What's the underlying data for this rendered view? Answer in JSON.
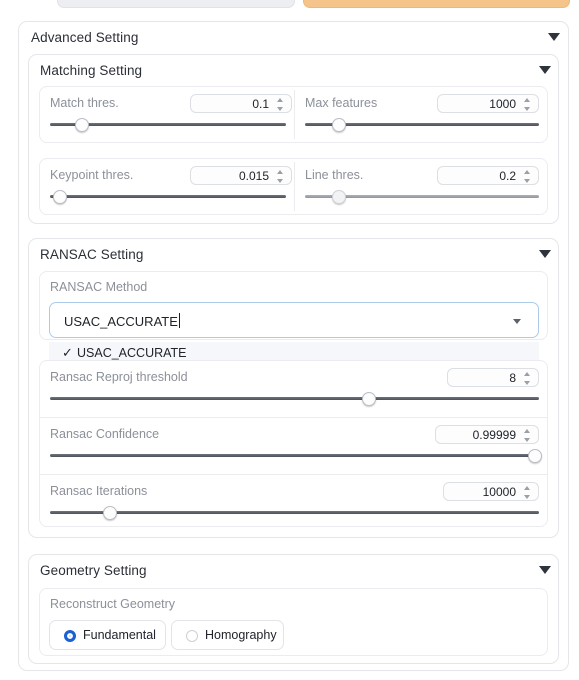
{
  "top_buttons": [
    {
      "name": "gray-button",
      "label": ""
    },
    {
      "name": "orange-button",
      "label": ""
    }
  ],
  "advanced": {
    "title": "Advanced Setting",
    "collapse_icon": "triangle-down-icon"
  },
  "matching": {
    "title": "Matching Setting",
    "fields": [
      {
        "label": "Match thres.",
        "value": "0.1",
        "slider_pct": 13
      },
      {
        "label": "Max features",
        "value": "1000",
        "slider_pct": 14
      },
      {
        "label": "Keypoint thres.",
        "value": "0.015",
        "slider_pct": 4
      },
      {
        "label": "Line thres.",
        "value": "0.2",
        "slider_pct": 14
      }
    ]
  },
  "ransac": {
    "title": "RANSAC Setting",
    "method_label": "RANSAC Method",
    "method_value": "USAC_ACCURATE",
    "dropdown_open": true,
    "options": [
      {
        "label": "USAC_ACCURATE",
        "selected": true,
        "check": "✓"
      }
    ],
    "fields": [
      {
        "label": "Ransac Reproj threshold",
        "value": "8",
        "slider_pct": 65
      },
      {
        "label": "Ransac Confidence",
        "value": "0.99999",
        "slider_pct": 99
      },
      {
        "label": "Ransac Iterations",
        "value": "10000",
        "slider_pct": 12
      }
    ]
  },
  "geometry": {
    "title": "Geometry Setting",
    "group_label": "Reconstruct Geometry",
    "options": [
      {
        "label": "Fundamental",
        "selected": true
      },
      {
        "label": "Homography",
        "selected": false
      }
    ]
  },
  "colors": {
    "accent_blue": "#1b61d1",
    "focus_border": "#accbeb",
    "orange": "#f5c48a",
    "label_gray": "#8c9099"
  }
}
